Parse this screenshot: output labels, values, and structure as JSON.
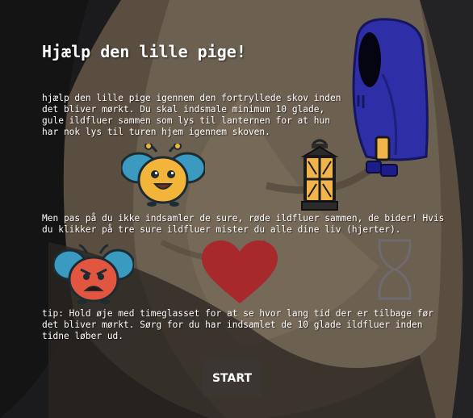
{
  "title": "Hjælp den lille pige!",
  "intro_text": "hjælp den lille pige igennem den fortryllede skov inden det bliver mørkt. Du skal indsmale minimum 10 glade, gule ildfluer sammen som lys til lanternen for at hun har nok lys til turen hjem igennem skoven.",
  "warning_text": "Men pas på du ikke indsamler de sure, røde ildfluer sammen, de bider! Hvis du klikker på tre sure ildfluer mister du alle dine liv (hjerter).",
  "tip_text": "tip: Hold øje med timeglasset for at se hvor lang tid der er tilbage før det bliver mørkt. Sørg for du har indsamlet de 10 glade ildfluer inden tidne løber ud.",
  "start_label": "START",
  "colors": {
    "happy_firefly": "#f2b53a",
    "angry_firefly": "#e2553f",
    "heart": "#a8292b",
    "girl_cloak": "#2e2ea6",
    "wing": "#3b9ac0"
  },
  "icons": [
    "happy-firefly-icon",
    "lantern-icon",
    "angry-firefly-icon",
    "heart-icon",
    "hourglass-icon",
    "girl-in-hood-icon"
  ]
}
